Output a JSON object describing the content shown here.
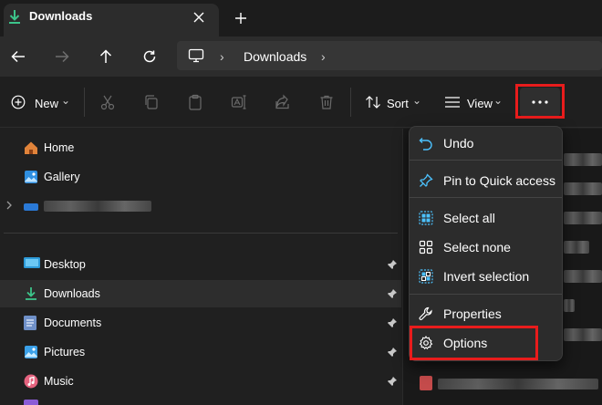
{
  "tab": {
    "title": "Downloads",
    "close_glyph": "✕",
    "new_glyph": "+"
  },
  "address": {
    "crumbs": [
      "Downloads"
    ],
    "separator": "›"
  },
  "toolbar": {
    "new_label": "New",
    "sort_label": "Sort",
    "view_label": "View",
    "more_glyph": "•••",
    "chevron": "⌄"
  },
  "sidebar": {
    "items": [
      {
        "label": "Home",
        "icon": "home-icon"
      },
      {
        "label": "Gallery",
        "icon": "gallery-icon"
      },
      {
        "label": "Desktop",
        "icon": "desktop-icon",
        "pinned": true
      },
      {
        "label": "Downloads",
        "icon": "downloads-icon",
        "pinned": true,
        "selected": true
      },
      {
        "label": "Documents",
        "icon": "documents-icon",
        "pinned": true
      },
      {
        "label": "Pictures",
        "icon": "pictures-icon",
        "pinned": true
      },
      {
        "label": "Music",
        "icon": "music-icon",
        "pinned": true
      }
    ]
  },
  "menu": {
    "items": [
      {
        "label": "Undo",
        "icon": "undo-icon"
      },
      {
        "label": "Pin to Quick access",
        "icon": "pin-icon"
      },
      {
        "label": "Select all",
        "icon": "select-all-icon"
      },
      {
        "label": "Select none",
        "icon": "select-none-icon"
      },
      {
        "label": "Invert selection",
        "icon": "invert-selection-icon"
      },
      {
        "label": "Properties",
        "icon": "wrench-icon"
      },
      {
        "label": "Options",
        "icon": "gear-icon"
      }
    ]
  },
  "colors": {
    "accent": "#4cc2ff",
    "highlight": "#e81c1c",
    "download_green": "#3cc48a"
  }
}
